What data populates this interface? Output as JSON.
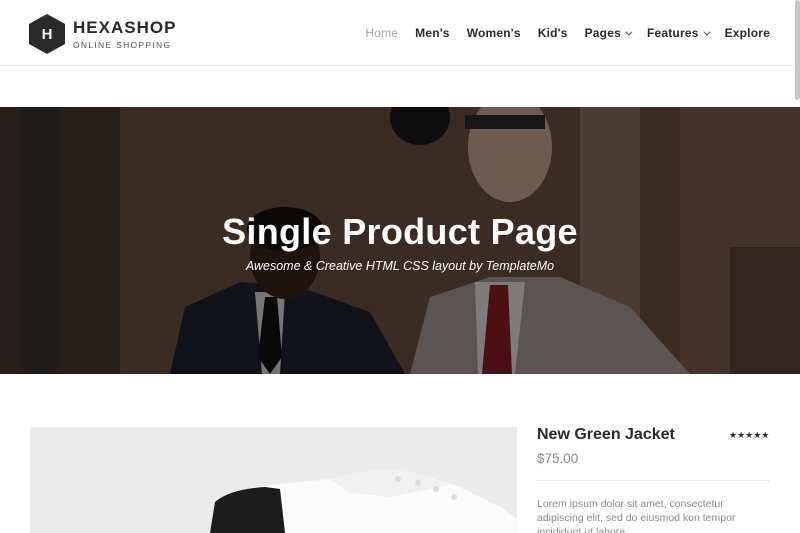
{
  "brand": {
    "logo_letter": "H",
    "name": "HEXASHOP",
    "tagline": "ONLINE SHOPPING"
  },
  "nav": {
    "items": [
      {
        "label": "Home",
        "active": true,
        "dropdown": false
      },
      {
        "label": "Men's",
        "active": false,
        "dropdown": false
      },
      {
        "label": "Women's",
        "active": false,
        "dropdown": false
      },
      {
        "label": "Kid's",
        "active": false,
        "dropdown": false
      },
      {
        "label": "Pages",
        "active": false,
        "dropdown": true
      },
      {
        "label": "Features",
        "active": false,
        "dropdown": true
      },
      {
        "label": "Explore",
        "active": false,
        "dropdown": false
      }
    ]
  },
  "hero": {
    "title": "Single Product Page",
    "subtitle": "Awesome & Creative HTML CSS layout by TemplateMo"
  },
  "product": {
    "name": "New Green Jacket",
    "price": "$75.00",
    "rating_stars": "★★★★★",
    "rating": 5,
    "description": "Lorem ipsum dolor sit amet, consectetur adipiscing elit, sed do eiusmod kon tempor incididunt ut labore"
  },
  "colors": {
    "primary_text": "#2a2a2a",
    "muted_text": "#8a8a8a",
    "active_nav": "#a6a6a6"
  }
}
